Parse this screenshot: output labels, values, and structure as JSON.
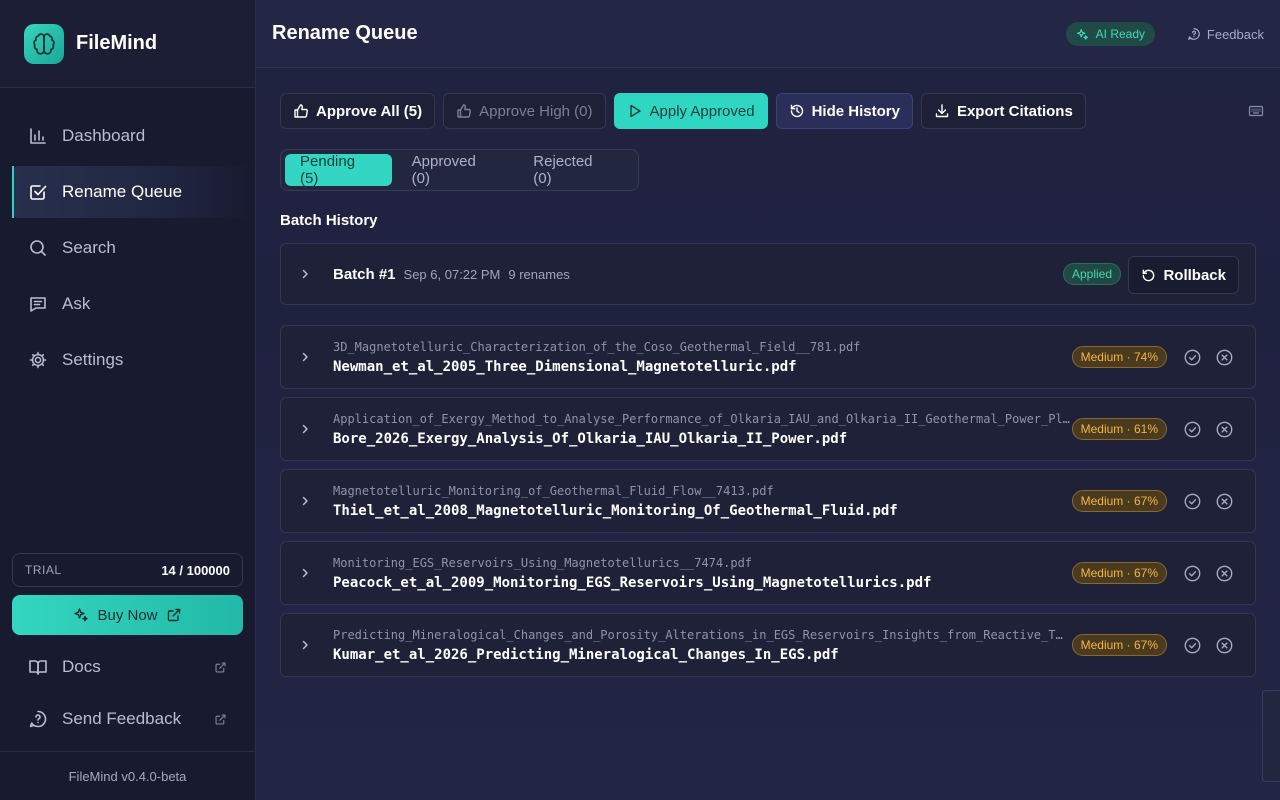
{
  "app": {
    "name": "FileMind",
    "version": "FileMind v0.4.0-beta"
  },
  "sidebar": {
    "items": [
      {
        "label": "Dashboard",
        "icon": "bar-chart-icon"
      },
      {
        "label": "Rename Queue",
        "icon": "checkbox-icon",
        "active": true
      },
      {
        "label": "Search",
        "icon": "search-icon"
      },
      {
        "label": "Ask",
        "icon": "message-icon"
      },
      {
        "label": "Settings",
        "icon": "gear-icon"
      }
    ],
    "trial": {
      "label": "TRIAL",
      "count": "14 / 100000"
    },
    "buy_label": "Buy Now",
    "docs_label": "Docs",
    "feedback_label": "Send Feedback"
  },
  "header": {
    "title": "Rename Queue",
    "ai_status": "AI Ready",
    "feedback_label": "Feedback"
  },
  "toolbar": {
    "approve_all": "Approve All (5)",
    "approve_high": "Approve High (0)",
    "apply_approved": "Apply Approved",
    "hide_history": "Hide History",
    "export_citations": "Export Citations"
  },
  "tabs": [
    {
      "label": "Pending (5)",
      "active": true
    },
    {
      "label": "Approved (0)"
    },
    {
      "label": "Rejected (0)"
    }
  ],
  "history": {
    "title": "Batch History",
    "batch": {
      "name": "Batch #1",
      "date": "Sep 6, 07:22 PM",
      "count": "9 renames",
      "status": "Applied",
      "rollback_label": "Rollback"
    }
  },
  "renames": [
    {
      "original": "3D_Magnetotelluric_Characterization_of_the_Coso_Geothermal_Field__781.pdf",
      "new": "Newman_et_al_2005_Three_Dimensional_Magnetotelluric.pdf",
      "confidence": "Medium · 74%"
    },
    {
      "original": "Application_of_Exergy_Method_to_Analyse_Performance_of_Olkaria_IAU_and_Olkaria_II_Geothermal_Power_Pl…",
      "new": "Bore_2026_Exergy_Analysis_Of_Olkaria_IAU_Olkaria_II_Power.pdf",
      "confidence": "Medium · 61%"
    },
    {
      "original": "Magnetotelluric_Monitoring_of_Geothermal_Fluid_Flow__7413.pdf",
      "new": "Thiel_et_al_2008_Magnetotelluric_Monitoring_Of_Geothermal_Fluid.pdf",
      "confidence": "Medium · 67%"
    },
    {
      "original": "Monitoring_EGS_Reservoirs_Using_Magnetotellurics__7474.pdf",
      "new": "Peacock_et_al_2009_Monitoring_EGS_Reservoirs_Using_Magnetotellurics.pdf",
      "confidence": "Medium · 67%"
    },
    {
      "original": "Predicting_Mineralogical_Changes_and_Porosity_Alterations_in_EGS_Reservoirs_Insights_from_Reactive_T…",
      "new": "Kumar_et_al_2026_Predicting_Mineralogical_Changes_In_EGS.pdf",
      "confidence": "Medium · 67%"
    }
  ],
  "colors": {
    "accent": "#2fd6c1",
    "medium_badge": "#f4b63f",
    "applied_badge": "#48d6b0"
  }
}
